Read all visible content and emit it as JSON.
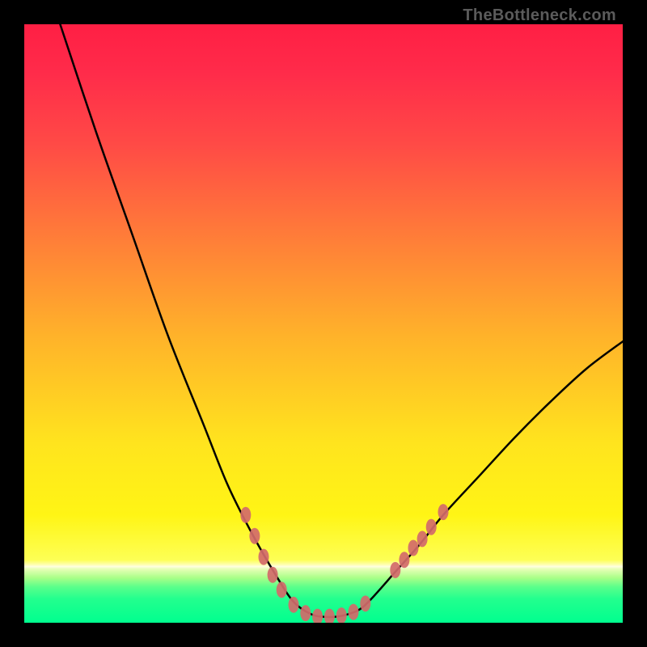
{
  "watermark": "TheBottleneck.com",
  "chart_data": {
    "type": "line",
    "title": "",
    "xlabel": "",
    "ylabel": "",
    "xlim": [
      0,
      100
    ],
    "ylim": [
      0,
      100
    ],
    "curve_points": [
      {
        "x": 6,
        "y": 100
      },
      {
        "x": 12,
        "y": 82
      },
      {
        "x": 18,
        "y": 65
      },
      {
        "x": 24,
        "y": 48
      },
      {
        "x": 30,
        "y": 33
      },
      {
        "x": 34,
        "y": 23
      },
      {
        "x": 38,
        "y": 15
      },
      {
        "x": 42,
        "y": 8
      },
      {
        "x": 45,
        "y": 3.5
      },
      {
        "x": 48,
        "y": 1.4
      },
      {
        "x": 50,
        "y": 1
      },
      {
        "x": 52,
        "y": 1
      },
      {
        "x": 54,
        "y": 1.4
      },
      {
        "x": 56,
        "y": 2.2
      },
      {
        "x": 58,
        "y": 4
      },
      {
        "x": 62,
        "y": 8.5
      },
      {
        "x": 66,
        "y": 13
      },
      {
        "x": 70,
        "y": 18
      },
      {
        "x": 76,
        "y": 24.5
      },
      {
        "x": 82,
        "y": 31
      },
      {
        "x": 88,
        "y": 37
      },
      {
        "x": 94,
        "y": 42.5
      },
      {
        "x": 100,
        "y": 47
      }
    ],
    "markers": [
      {
        "x": 37,
        "y": 18
      },
      {
        "x": 38.5,
        "y": 14.5
      },
      {
        "x": 40,
        "y": 11
      },
      {
        "x": 41.5,
        "y": 8
      },
      {
        "x": 43,
        "y": 5.5
      },
      {
        "x": 45,
        "y": 3
      },
      {
        "x": 47,
        "y": 1.6
      },
      {
        "x": 49,
        "y": 1
      },
      {
        "x": 51,
        "y": 1
      },
      {
        "x": 53,
        "y": 1.2
      },
      {
        "x": 55,
        "y": 1.8
      },
      {
        "x": 57,
        "y": 3.2
      },
      {
        "x": 62,
        "y": 8.8
      },
      {
        "x": 63.5,
        "y": 10.5
      },
      {
        "x": 65,
        "y": 12.5
      },
      {
        "x": 66.5,
        "y": 14
      },
      {
        "x": 68,
        "y": 16
      },
      {
        "x": 70,
        "y": 18.5
      }
    ],
    "marker_rx": 6.5,
    "marker_ry": 10
  }
}
